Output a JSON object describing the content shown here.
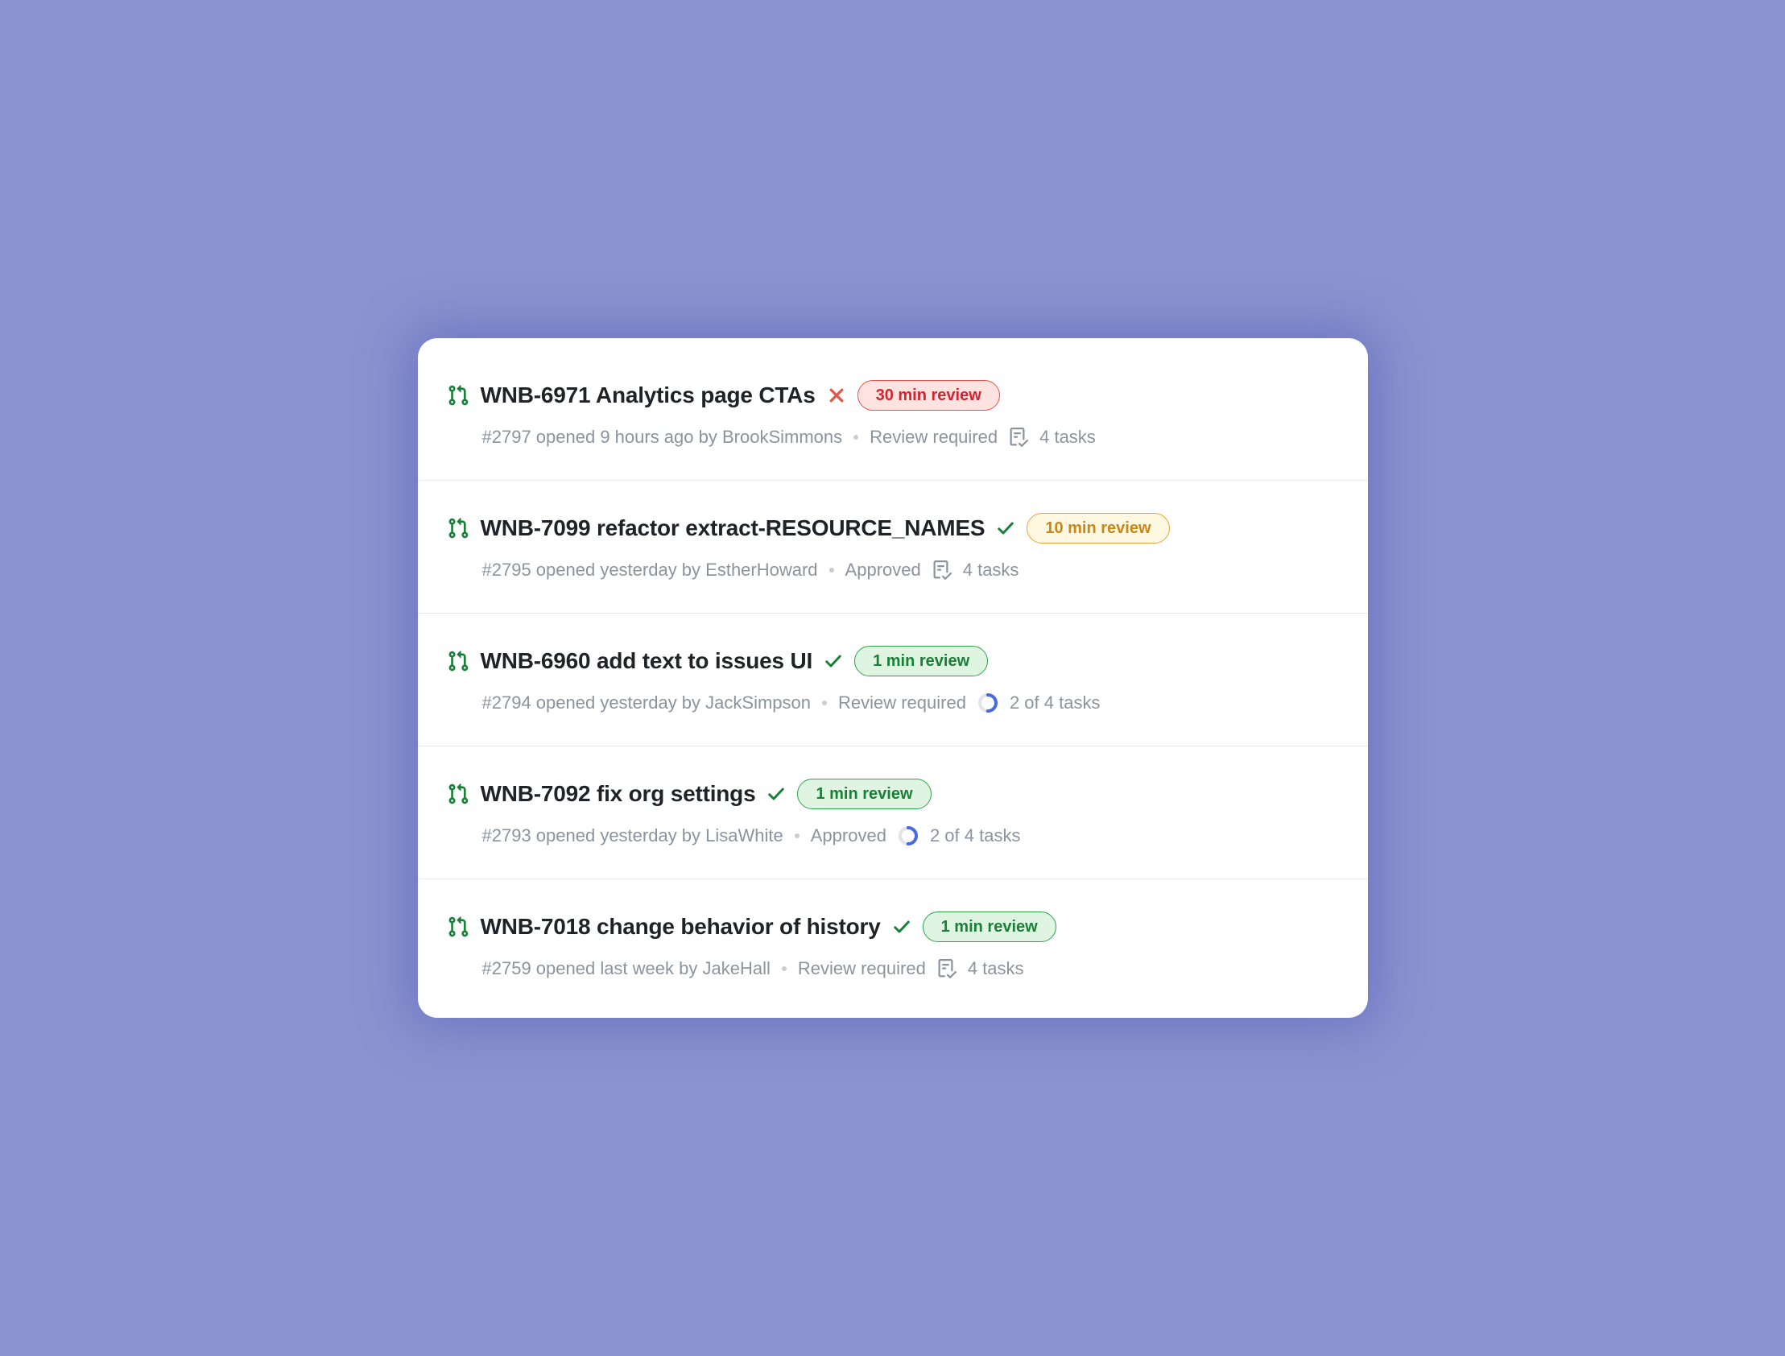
{
  "pull_requests": [
    {
      "title": "WNB-6971 Analytics page CTAs",
      "status": "fail",
      "review_badge": {
        "label": "30 min review",
        "variant": "red"
      },
      "meta": "#2797 opened 9 hours ago by BrookSimmons",
      "review_status": "Review required",
      "tasks_label": "4 tasks",
      "progress": null
    },
    {
      "title": "WNB-7099 refactor extract-RESOURCE_NAMES",
      "status": "pass",
      "review_badge": {
        "label": "10 min review",
        "variant": "yellow"
      },
      "meta": "#2795 opened yesterday by  EstherHoward",
      "review_status": "Approved",
      "tasks_label": "4 tasks",
      "progress": null
    },
    {
      "title": "WNB-6960 add text to issues UI",
      "status": "pass",
      "review_badge": {
        "label": "1 min review",
        "variant": "green"
      },
      "meta": "#2794 opened yesterday by JackSimpson",
      "review_status": "Review required",
      "tasks_label": "2 of 4 tasks",
      "progress": 0.5
    },
    {
      "title": "WNB-7092 fix org settings",
      "status": "pass",
      "review_badge": {
        "label": "1 min review",
        "variant": "green"
      },
      "meta": "#2793 opened yesterday by LisaWhite",
      "review_status": "Approved",
      "tasks_label": "2 of 4 tasks",
      "progress": 0.5
    },
    {
      "title": "WNB-7018 change behavior of history",
      "status": "pass",
      "review_badge": {
        "label": "1 min review",
        "variant": "green"
      },
      "meta": "#2759 opened last week by JakeHall",
      "review_status": "Review required",
      "tasks_label": "4 tasks",
      "progress": null
    }
  ]
}
